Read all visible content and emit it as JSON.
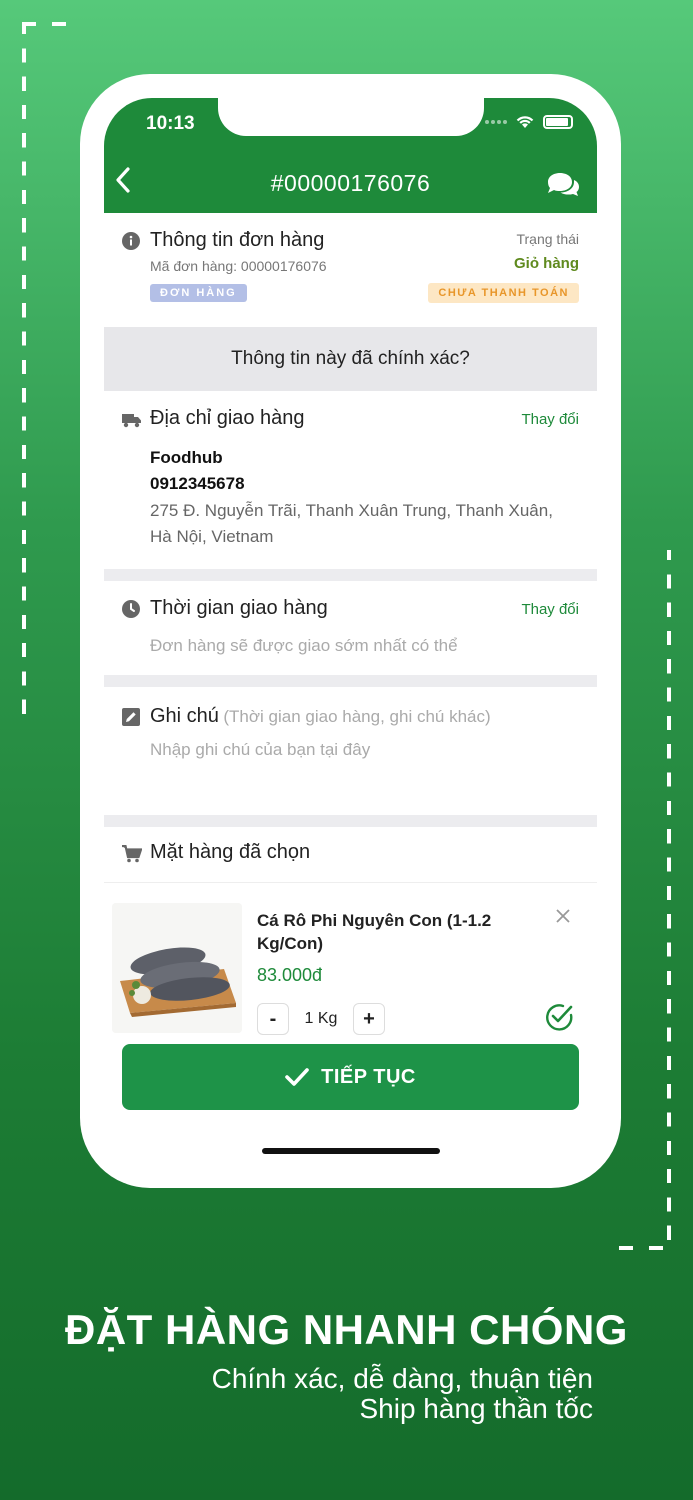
{
  "status_bar": {
    "time": "10:13"
  },
  "header": {
    "title": "#00000176076"
  },
  "order_info": {
    "title": "Thông tin đơn hàng",
    "order_code": "Mã đơn hàng: 00000176076",
    "badge": "ĐƠN HÀNG",
    "status_label": "Trạng thái",
    "status_value": "Giỏ hàng",
    "payment_badge": "CHƯA THANH TOÁN"
  },
  "confirm_prompt": "Thông tin này đã chính xác?",
  "address": {
    "title": "Địa chỉ giao hàng",
    "change": "Thay đổi",
    "name": "Foodhub",
    "phone": "0912345678",
    "line": "275 Đ. Nguyễn Trãi, Thanh Xuân Trung, Thanh Xuân, Hà Nội, Vietnam"
  },
  "delivery_time": {
    "title": "Thời gian giao hàng",
    "change": "Thay đổi",
    "value": "Đơn hàng sẽ được giao sớm nhất có thể"
  },
  "note": {
    "title": "Ghi chú",
    "hint": "(Thời gian giao hàng, ghi chú khác)",
    "placeholder": "Nhập ghi chú của bạn tại đây"
  },
  "items": {
    "title": "Mặt hàng đã chọn",
    "list": [
      {
        "name": "Cá Rô Phi Nguyên Con (1-1.2 Kg/Con)",
        "price": "83.000đ",
        "quantity": "1 Kg",
        "minus": "-",
        "plus": "+"
      }
    ]
  },
  "cta": {
    "label": "TIẾP TỤC"
  },
  "tagline": {
    "main": "ĐẶT HÀNG NHANH CHÓNG",
    "line1": "Chính xác, dễ dàng, thuận tiện",
    "line2": "Ship hàng thần tốc"
  },
  "colors": {
    "brand_green": "#1e8a3a",
    "cta_green": "#1e9348",
    "status_olive": "#5f8a1e",
    "payment_orange": "#e8962a"
  }
}
